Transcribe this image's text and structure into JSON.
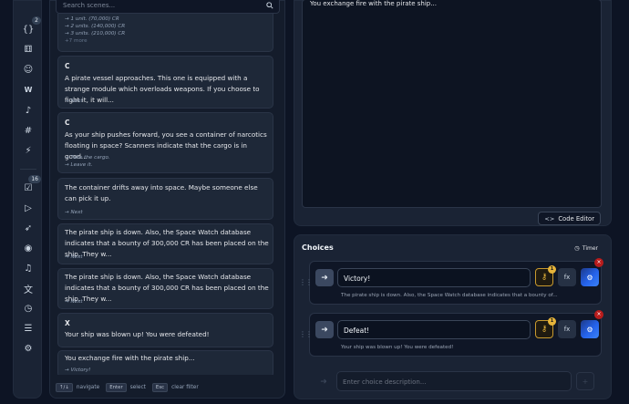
{
  "rail": {
    "items": [
      {
        "icon": "curly-braces-icon",
        "glyph": "{}",
        "badge": "2"
      },
      {
        "icon": "dice-icon",
        "glyph": "⚅",
        "badge": ""
      },
      {
        "icon": "person-icon",
        "glyph": "☺",
        "badge": ""
      },
      {
        "icon": "logo-icon",
        "glyph": "W",
        "badge": ""
      },
      {
        "icon": "music-note-icon",
        "glyph": "♪",
        "badge": ""
      },
      {
        "icon": "hash-icon",
        "glyph": "#",
        "badge": ""
      },
      {
        "icon": "lightning-icon",
        "glyph": "⚡",
        "badge": ""
      },
      {
        "icon": "checklist-icon",
        "glyph": "☑",
        "badge": "16"
      },
      {
        "icon": "play-icon",
        "glyph": "▷",
        "badge": ""
      },
      {
        "icon": "rocket-icon",
        "glyph": "➶",
        "badge": ""
      },
      {
        "icon": "palette-icon",
        "glyph": "◉",
        "badge": ""
      },
      {
        "icon": "voice-icon",
        "glyph": "♫",
        "badge": ""
      },
      {
        "icon": "translate-icon",
        "glyph": "文",
        "badge": ""
      },
      {
        "icon": "clock-icon",
        "glyph": "◷",
        "badge": ""
      },
      {
        "icon": "notes-icon",
        "glyph": "☰",
        "badge": ""
      },
      {
        "icon": "settings-icon",
        "glyph": "⚙",
        "badge": ""
      }
    ]
  },
  "search": {
    "placeholder": "Search scenes..."
  },
  "scenes": [
    {
      "header": "",
      "text": "",
      "options": [
        "→ 1 unit. (70,000) CR",
        "→ 2 units. (140,000) CR",
        "→ 3 units. (210,000) CR"
      ],
      "more": "+7 more"
    },
    {
      "header": "C",
      "text": "A pirate vessel approaches. This one is equipped with a strange module which overloads weapons. If you choose to fight it, it will...",
      "options": [
        "→ Next"
      ],
      "more": ""
    },
    {
      "header": "C",
      "text": "As your ship pushes forward, you see a container of narcotics floating in space? Scanners indicate that the cargo is in good...",
      "options": [
        "→ Take the cargo.",
        "→ Leave it."
      ],
      "more": ""
    },
    {
      "header": "",
      "text": "The container drifts away into space. Maybe someone else can pick it up.",
      "options": [
        "→ Next"
      ],
      "more": ""
    },
    {
      "header": "",
      "text": "The pirate ship is down. Also, the Space Watch database indicates that a bounty of 300,000 CR has been placed on the ship. They w...",
      "options": [
        "→ Next"
      ],
      "more": ""
    },
    {
      "header": "",
      "text": "The pirate ship is down. Also, the Space Watch database indicates that a bounty of 300,000 CR has been placed on the ship. They w...",
      "options": [
        "→ Next"
      ],
      "more": ""
    },
    {
      "header": "X",
      "text": "Your ship was blown up! You were defeated!",
      "options": [],
      "more": ""
    },
    {
      "header": "",
      "text": "You exchange fire with the pirate ship...",
      "options": [
        "→ Victory!"
      ],
      "more": ""
    }
  ],
  "footer": {
    "nav_key": "↑/↓",
    "nav_label": "navigate",
    "select_key": "Enter",
    "select_label": "select",
    "clear_key": "Esc",
    "clear_label": "clear filter"
  },
  "editor": {
    "text": "You exchange fire with the pirate ship...",
    "code_editor_label": "Code Editor"
  },
  "choices": {
    "title": "Choices",
    "timer_label": "Timer",
    "items": [
      {
        "label": "Victory!",
        "key_count": "1",
        "fx": "fx",
        "subtitle": "The pirate ship is down. Also, the Space Watch database indicates that a bounty of..."
      },
      {
        "label": "Defeat!",
        "key_count": "1",
        "fx": "fx",
        "subtitle": "Your ship was blown up! You were defeated!"
      }
    ],
    "new_placeholder": "Enter choice description..."
  },
  "colors": {
    "accent": "#2563eb",
    "key_gold": "#e5b33a",
    "delete_red": "#b91c1c"
  }
}
